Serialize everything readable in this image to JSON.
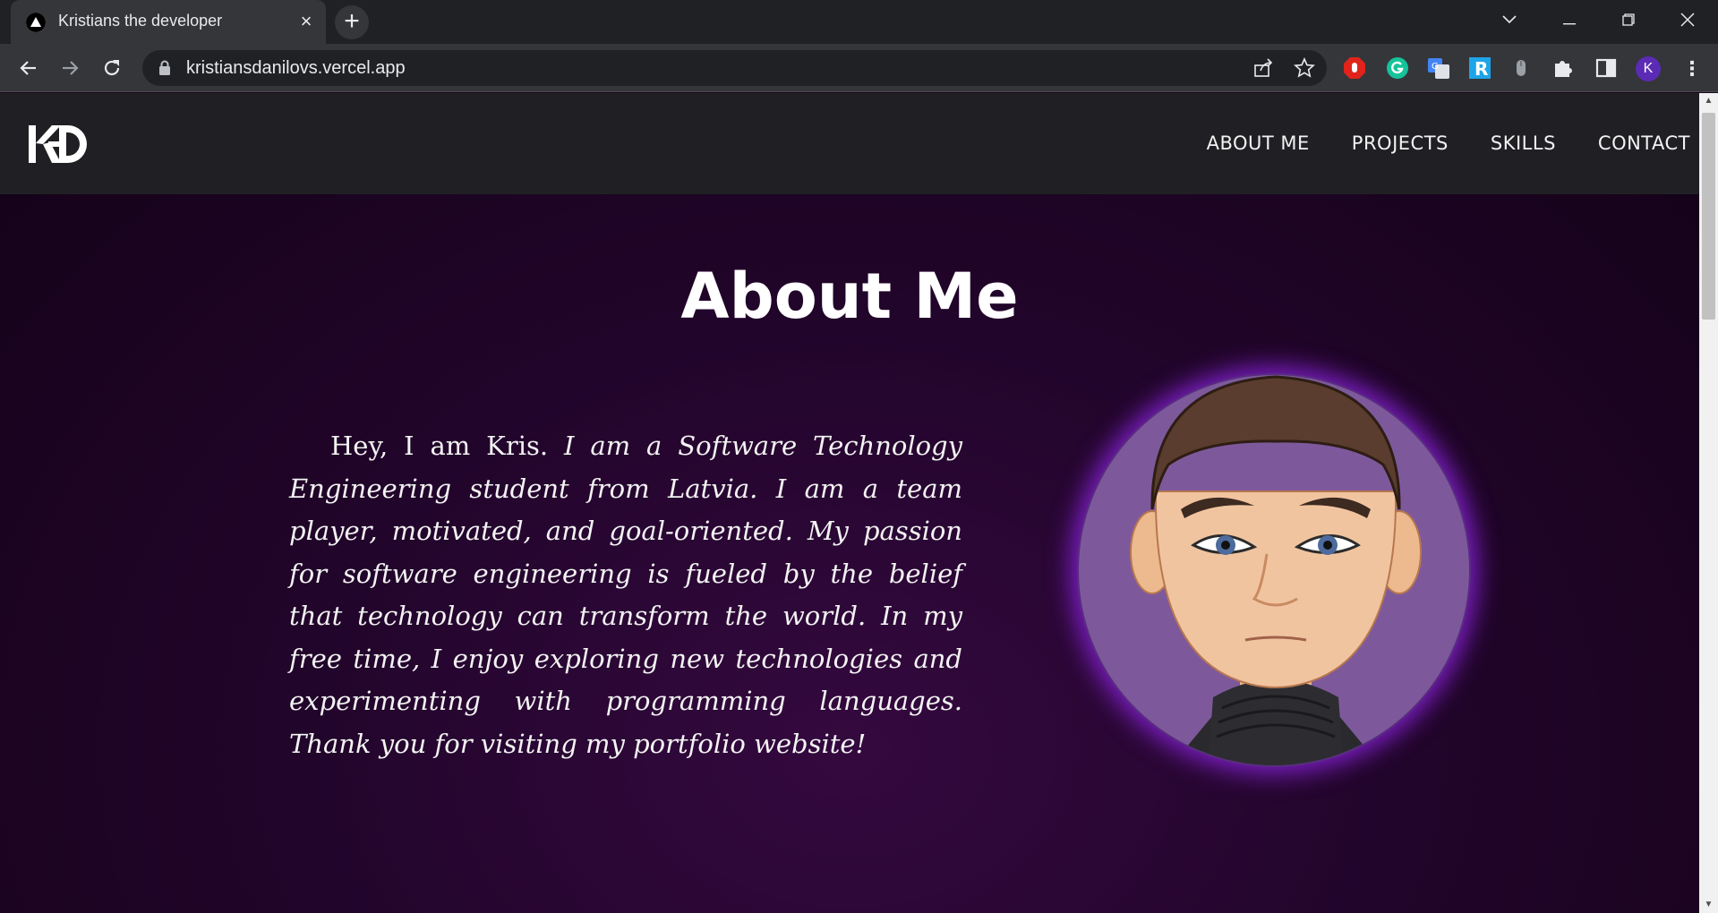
{
  "browser": {
    "tab_title": "Kristians the developer",
    "tab_close": "×",
    "new_tab": "+",
    "url": "kristiansdanilovs.vercel.app",
    "profile_initial": "K",
    "window_controls": {
      "dropdown": "⌄",
      "minimize": "—",
      "restore": "❐",
      "close": "✕"
    }
  },
  "site": {
    "logo_text": "KD",
    "nav": [
      "ABOUT ME",
      "PROJECTS",
      "SKILLS",
      "CONTACT"
    ],
    "heading": "About Me",
    "bio_plain": "Hey, I am Kris.",
    "bio_italic": "I am a Software Technology Engineering student from Latvia. I am a team player, motivated, and goal-oriented. My passion for software engineering is fueled by the belief that technology can transform the world. In my free time, I enjoy exploring new technologies and experimenting with programming languages. Thank you for visiting my portfolio website!"
  },
  "colors": {
    "accent_glow": "#7a1ec0",
    "portrait_bg": "#7d599c",
    "header_bg": "#202024"
  }
}
